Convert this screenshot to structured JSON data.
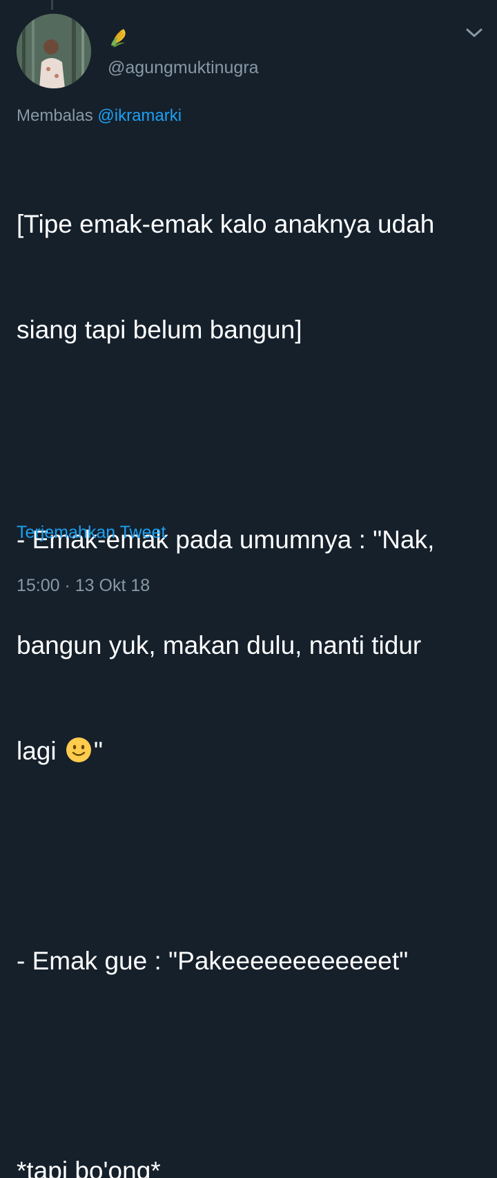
{
  "tweet": {
    "display_name_icon": "corn-emoji-icon",
    "handle": "@agungmuktinugra",
    "replying_prefix": "Membalas",
    "replying_to": "@ikramarki",
    "lines": {
      "l1": "[Tipe emak-emak kalo anaknya udah",
      "l2": "siang tapi belum bangun]",
      "l3": "- Emak-emak pada umumnya : \"Nak,",
      "l4": "bangun yuk, makan dulu, nanti tidur",
      "l5_before": "lagi",
      "l5_after": "\"",
      "l6": "- Emak gue : \"Pakeeeeeeeeeeeet\"",
      "l7": "*tapi bo'ong*"
    },
    "translate_label": "Terjemahkan Tweet",
    "timestamp": "15:00 · 13 Okt 18"
  },
  "colors": {
    "background": "#15202b",
    "secondary_text": "#8899a6",
    "link": "#1da1f2"
  }
}
